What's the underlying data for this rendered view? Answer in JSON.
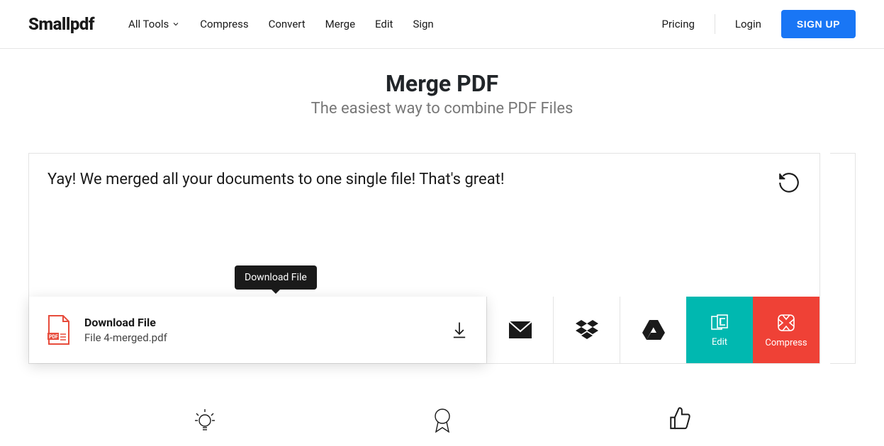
{
  "header": {
    "logo": "Smallpdf",
    "nav": {
      "all_tools": "All Tools",
      "compress": "Compress",
      "convert": "Convert",
      "merge": "Merge",
      "edit": "Edit",
      "sign": "Sign"
    },
    "right": {
      "pricing": "Pricing",
      "login": "Login",
      "signup": "SIGN UP"
    }
  },
  "page": {
    "title": "Merge PDF",
    "subtitle": "The easiest way to combine PDF Files"
  },
  "result": {
    "message": "Yay! We merged all your documents to one single file! That's great!"
  },
  "download": {
    "tooltip": "Download File",
    "title": "Download File",
    "filename": "File 4-merged.pdf"
  },
  "actions": {
    "edit": "Edit",
    "compress": "Compress"
  }
}
